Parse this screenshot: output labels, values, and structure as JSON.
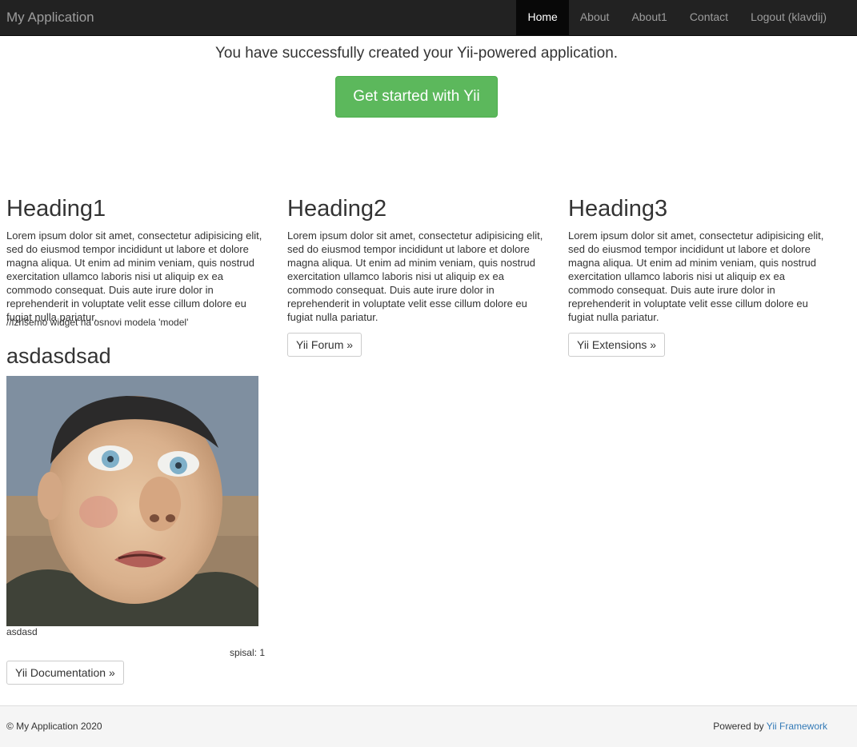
{
  "navbar": {
    "brand": "My Application",
    "items": [
      {
        "label": "Home",
        "active": true
      },
      {
        "label": "About",
        "active": false
      },
      {
        "label": "About1",
        "active": false
      },
      {
        "label": "Contact",
        "active": false
      },
      {
        "label": "Logout (klavdij)",
        "active": false
      }
    ]
  },
  "jumbotron": {
    "lead": "You have successfully created your Yii-powered application.",
    "button": "Get started with Yii"
  },
  "columns": [
    {
      "heading": "Heading1",
      "text": "Lorem ipsum dolor sit amet, consectetur adipisicing elit, sed do eiusmod tempor incididunt ut labore et dolore magna aliqua. Ut enim ad minim veniam, quis nostrud exercitation ullamco laboris nisi ut aliquip ex ea commodo consequat. Duis aute irure dolor in reprehenderit in voluptate velit esse cillum dolore eu fugiat nulla pariatur.",
      "button": "Yii Documentation »"
    },
    {
      "heading": "Heading2",
      "text": "Lorem ipsum dolor sit amet, consectetur adipisicing elit, sed do eiusmod tempor incididunt ut labore et dolore magna aliqua. Ut enim ad minim veniam, quis nostrud exercitation ullamco laboris nisi ut aliquip ex ea commodo consequat. Duis aute irure dolor in reprehenderit in voluptate velit esse cillum dolore eu fugiat nulla pariatur.",
      "button": "Yii Forum »"
    },
    {
      "heading": "Heading3",
      "text": "Lorem ipsum dolor sit amet, consectetur adipisicing elit, sed do eiusmod tempor incididunt ut labore et dolore magna aliqua. Ut enim ad minim veniam, quis nostrud exercitation ullamco laboris nisi ut aliquip ex ea commodo consequat. Duis aute irure dolor in reprehenderit in voluptate velit esse cillum dolore eu fugiat nulla pariatur.",
      "button": "Yii Extensions »"
    }
  ],
  "widget": {
    "comment": "//izrišemo widget na osnovi modela 'model'",
    "title": "asdasdsad",
    "caption": "asdasd",
    "author": "spisal: 1"
  },
  "footer": {
    "copyright": "© My Application 2020",
    "powered_prefix": "Powered by",
    "powered_link": "Yii Framework",
    "link_color": "#337ab7"
  },
  "colors": {
    "navbar_bg": "#222222",
    "success": "#5cb85c",
    "footer_bg": "#f5f5f5"
  }
}
